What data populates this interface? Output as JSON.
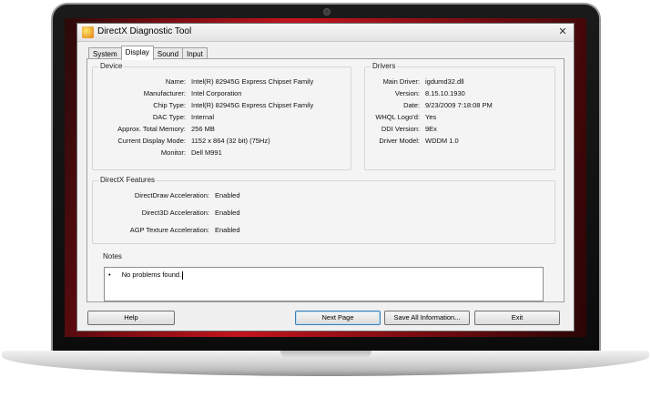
{
  "window": {
    "title": "DirectX Diagnostic Tool",
    "close_glyph": "✕"
  },
  "tabs": [
    "System",
    "Display",
    "Sound",
    "Input"
  ],
  "device": {
    "title": "Device",
    "rows": [
      {
        "label": "Name:",
        "value": "Intel(R) 82945G Express Chipset Family"
      },
      {
        "label": "Manufacturer:",
        "value": "Intel Corporation"
      },
      {
        "label": "Chip Type:",
        "value": "Intel(R) 82945G Express Chipset Family"
      },
      {
        "label": "DAC Type:",
        "value": "Internal"
      },
      {
        "label": "Approx. Total Memory:",
        "value": "256 MB"
      },
      {
        "label": "Current Display Mode:",
        "value": "1152 x 864 (32 bit) (75Hz)"
      },
      {
        "label": "Monitor:",
        "value": "Dell M991"
      }
    ]
  },
  "drivers": {
    "title": "Drivers",
    "rows": [
      {
        "label": "Main Driver:",
        "value": "igdumd32.dll"
      },
      {
        "label": "Version:",
        "value": "8.15.10.1930"
      },
      {
        "label": "Date:",
        "value": "9/23/2009 7:18:08 PM"
      },
      {
        "label": "WHQL Logo'd:",
        "value": "Yes"
      },
      {
        "label": "DDI Version:",
        "value": "9Ex"
      },
      {
        "label": "Driver Model:",
        "value": "WDDM 1.0"
      }
    ]
  },
  "features": {
    "title": "DirectX Features",
    "rows": [
      {
        "label": "DirectDraw Acceleration:",
        "value": "Enabled"
      },
      {
        "label": "Direct3D Acceleration:",
        "value": "Enabled"
      },
      {
        "label": "AGP Texture Acceleration:",
        "value": "Enabled"
      }
    ]
  },
  "notes": {
    "title": "Notes",
    "bullet": "•",
    "text": "No problems found."
  },
  "buttons": {
    "help": "Help",
    "next_page": "Next Page",
    "save_all": "Save All Information...",
    "exit": "Exit"
  },
  "colors": {
    "screen_red": "#c4141e",
    "dialog_bg": "#f0f0f0",
    "default_button_border": "#3c7fb1"
  }
}
